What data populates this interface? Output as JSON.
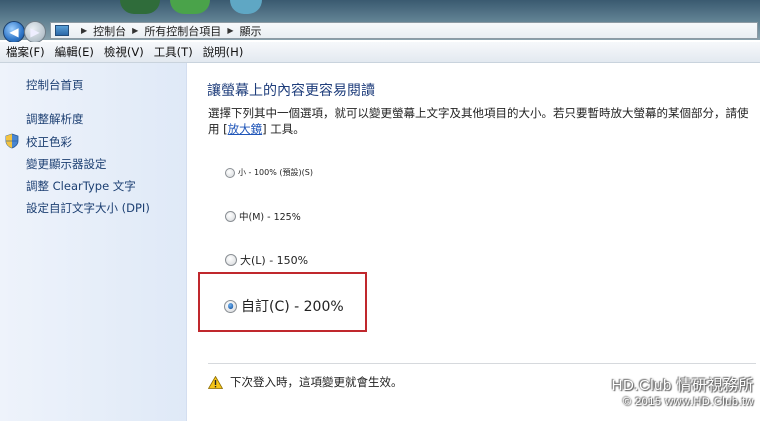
{
  "addressbar": {
    "crumbs": [
      "控制台",
      "所有控制台項目",
      "顯示"
    ],
    "separator": "▶"
  },
  "menubar": {
    "items": [
      "檔案(F)",
      "編輯(E)",
      "檢視(V)",
      "工具(T)",
      "說明(H)"
    ]
  },
  "sidebar": {
    "home": "控制台首頁",
    "links": [
      "調整解析度",
      "校正色彩",
      "變更顯示器設定",
      "調整 ClearType 文字",
      "設定自訂文字大小 (DPI)"
    ]
  },
  "main": {
    "heading": "讓螢幕上的內容更容易閱讀",
    "desc_part1": "選擇下列其中一個選項，就可以變更螢幕上文字及其他項目的大小。若只要暫時放大螢幕的某個部分，請使用 [",
    "desc_link": "放大鏡",
    "desc_part2": "] 工具。",
    "options": [
      {
        "label": "小 - 100% (預設)(S)",
        "selected": false
      },
      {
        "label": "中(M) - 125%",
        "selected": false
      },
      {
        "label": "大(L) - 150%",
        "selected": false
      },
      {
        "label": "自訂(C) - 200%",
        "selected": true
      }
    ],
    "warning": "下次登入時，這項變更就會生效。"
  },
  "watermark": {
    "line1": "HD.Club 情研視務所",
    "line2": "© 2015  www.HD.Club.tw"
  },
  "colors": {
    "highlight_box": "#c0282d",
    "heading": "#1e3d7b",
    "link": "#1f55b8"
  }
}
